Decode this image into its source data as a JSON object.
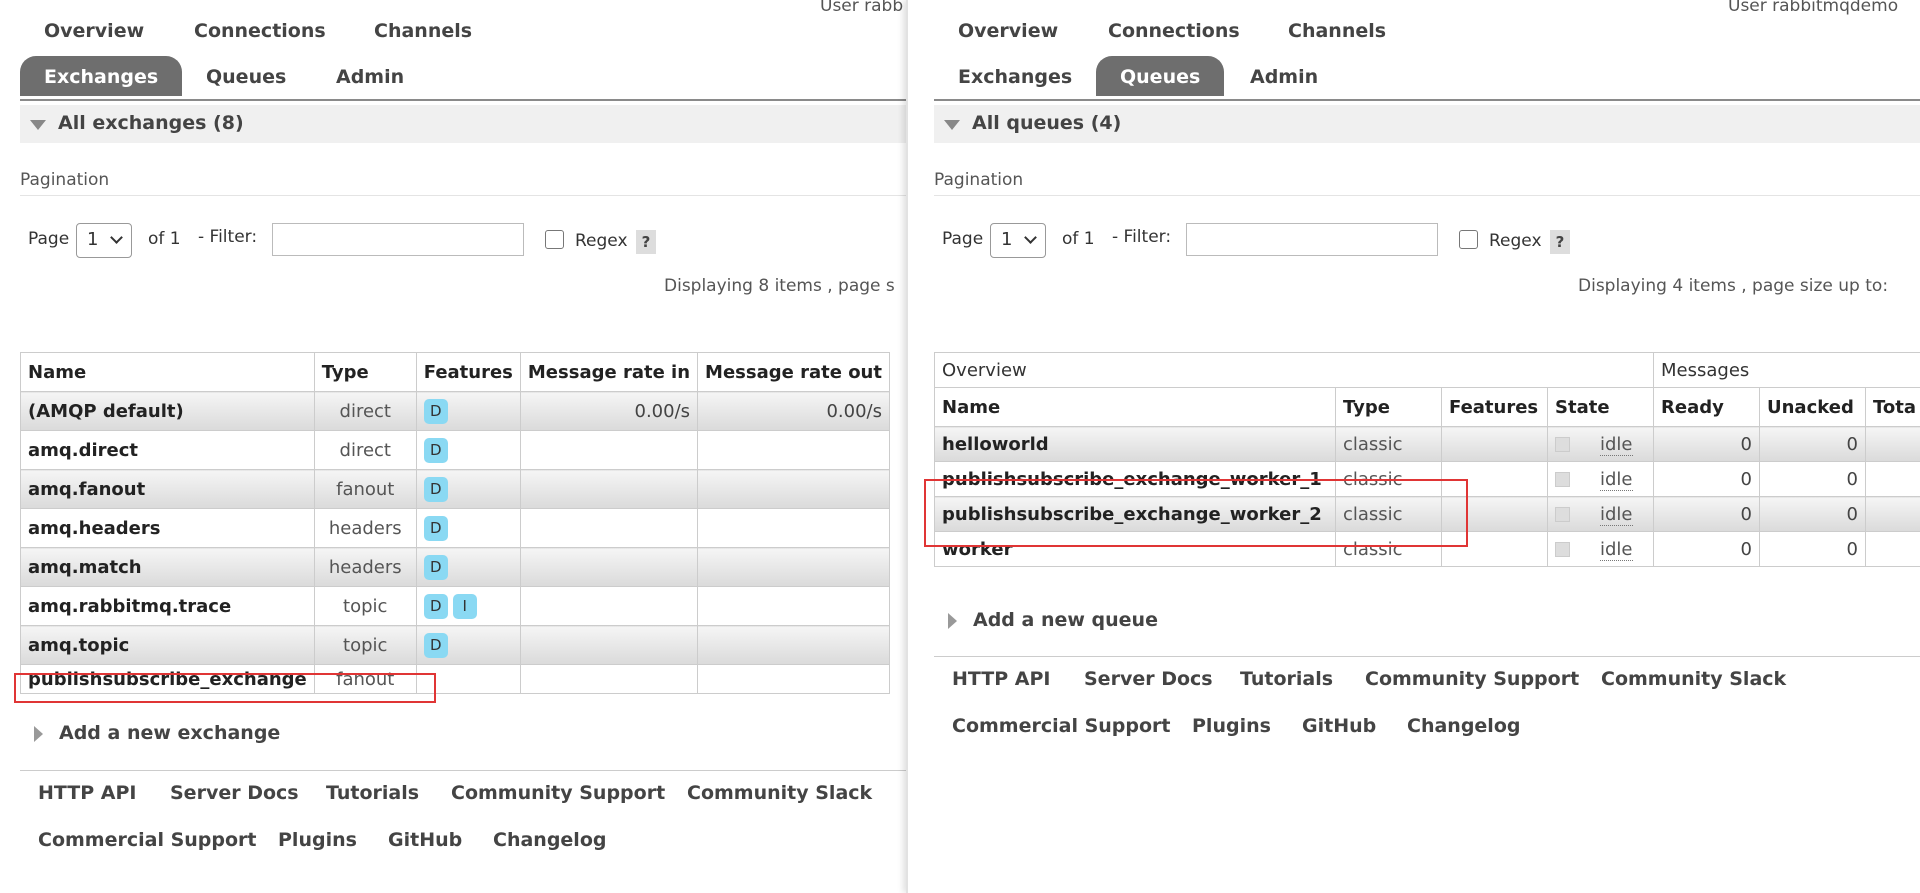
{
  "left": {
    "user_text": "User rabb",
    "nav_row1": [
      "Overview",
      "Connections",
      "Channels"
    ],
    "nav_row2": [
      {
        "label": "Exchanges",
        "active": true
      },
      {
        "label": "Queues",
        "active": false
      },
      {
        "label": "Admin",
        "active": false
      }
    ],
    "section_title": "All exchanges (8)",
    "pagination_label": "Pagination",
    "page_label": "Page",
    "page_value": "1",
    "of_label": "of 1",
    "filter_label": "- Filter:",
    "filter_value": "",
    "regex_label": "Regex",
    "regex_checked": false,
    "help_label": "?",
    "display_text": "Displaying 8 items , page s",
    "columns": [
      "Name",
      "Type",
      "Features",
      "Message rate in",
      "Message rate out"
    ],
    "rows": [
      {
        "name": "(AMQP default)",
        "type": "direct",
        "features": [
          "D"
        ],
        "rate_in": "0.00/s",
        "rate_out": "0.00/s"
      },
      {
        "name": "amq.direct",
        "type": "direct",
        "features": [
          "D"
        ],
        "rate_in": "",
        "rate_out": ""
      },
      {
        "name": "amq.fanout",
        "type": "fanout",
        "features": [
          "D"
        ],
        "rate_in": "",
        "rate_out": ""
      },
      {
        "name": "amq.headers",
        "type": "headers",
        "features": [
          "D"
        ],
        "rate_in": "",
        "rate_out": ""
      },
      {
        "name": "amq.match",
        "type": "headers",
        "features": [
          "D"
        ],
        "rate_in": "",
        "rate_out": ""
      },
      {
        "name": "amq.rabbitmq.trace",
        "type": "topic",
        "features": [
          "D",
          "I"
        ],
        "rate_in": "",
        "rate_out": ""
      },
      {
        "name": "amq.topic",
        "type": "topic",
        "features": [
          "D"
        ],
        "rate_in": "",
        "rate_out": ""
      },
      {
        "name": "publishsubscribe_exchange",
        "type": "fanout",
        "features": [],
        "rate_in": "",
        "rate_out": ""
      }
    ],
    "add_label": "Add a new exchange",
    "footer_row1": [
      "HTTP API",
      "Server Docs",
      "Tutorials",
      "Community Support",
      "Community Slack"
    ],
    "footer_row2": [
      "Commercial Support",
      "Plugins",
      "GitHub",
      "Changelog"
    ]
  },
  "right": {
    "user_text": "User rabbitmqdemo",
    "nav_row1": [
      "Overview",
      "Connections",
      "Channels"
    ],
    "nav_row2": [
      {
        "label": "Exchanges",
        "active": false
      },
      {
        "label": "Queues",
        "active": true
      },
      {
        "label": "Admin",
        "active": false
      }
    ],
    "section_title": "All queues (4)",
    "pagination_label": "Pagination",
    "page_label": "Page",
    "page_value": "1",
    "of_label": "of 1",
    "filter_label": "- Filter:",
    "filter_value": "",
    "regex_label": "Regex",
    "regex_checked": false,
    "help_label": "?",
    "display_text": "Displaying 4 items , page size up to:",
    "group_headers": [
      "Overview",
      "Messages"
    ],
    "columns": [
      "Name",
      "Type",
      "Features",
      "State",
      "Ready",
      "Unacked",
      "Tota"
    ],
    "rows": [
      {
        "name": "helloworld",
        "type": "classic",
        "features": "",
        "state": "idle",
        "ready": "0",
        "unacked": "0",
        "total": ""
      },
      {
        "name": "publishsubscribe_exchange_worker_1",
        "type": "classic",
        "features": "",
        "state": "idle",
        "ready": "0",
        "unacked": "0",
        "total": ""
      },
      {
        "name": "publishsubscribe_exchange_worker_2",
        "type": "classic",
        "features": "",
        "state": "idle",
        "ready": "0",
        "unacked": "0",
        "total": ""
      },
      {
        "name": "worker",
        "type": "classic",
        "features": "",
        "state": "idle",
        "ready": "0",
        "unacked": "0",
        "total": ""
      }
    ],
    "add_label": "Add a new queue",
    "footer_row1": [
      "HTTP API",
      "Server Docs",
      "Tutorials",
      "Community Support",
      "Community Slack"
    ],
    "footer_row2": [
      "Commercial Support",
      "Plugins",
      "GitHub",
      "Changelog"
    ]
  },
  "colors": {
    "highlight": "#e03535",
    "active_tab": "#6e6e6e",
    "feature_badge": "#8ad9f3"
  }
}
